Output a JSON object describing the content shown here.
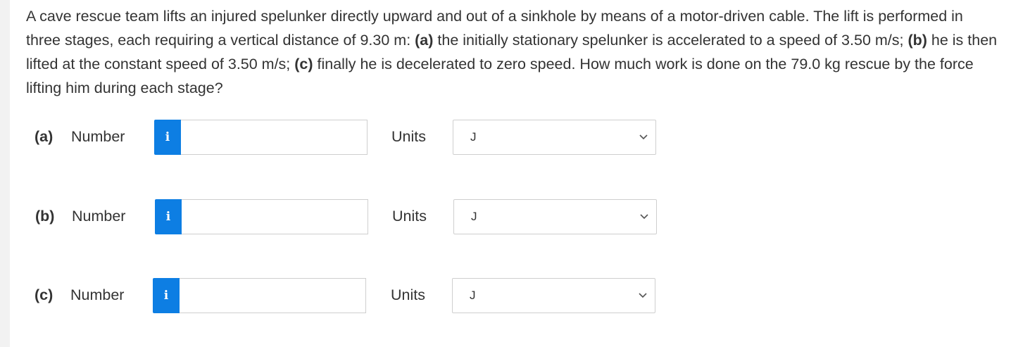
{
  "question": {
    "seg1": "A cave rescue team lifts an injured spelunker directly upward and out of a sinkhole by means of a motor-driven cable. The lift is performed in three stages, each requiring a vertical distance of 9.30 m: ",
    "label_a": "(a)",
    "seg2": " the initially stationary spelunker is accelerated to a speed of 3.50 m/s; ",
    "label_b": "(b)",
    "seg3": " he is then lifted at the constant speed of 3.50 m/s; ",
    "label_c": "(c)",
    "seg4": " finally he is decelerated to zero speed. How much work is done on the 79.0 kg rescue by the force lifting him during each stage?"
  },
  "parts": [
    {
      "label": "(a)",
      "number_label": "Number",
      "info_icon": "i",
      "value": "",
      "units_label": "Units",
      "units_value": "J"
    },
    {
      "label": "(b)",
      "number_label": "Number",
      "info_icon": "i",
      "value": "",
      "units_label": "Units",
      "units_value": "J"
    },
    {
      "label": "(c)",
      "number_label": "Number",
      "info_icon": "i",
      "value": "",
      "units_label": "Units",
      "units_value": "J"
    }
  ],
  "colors": {
    "info_button": "#0d7ee3",
    "background": "#f2f2f2",
    "card": "#ffffff",
    "text": "#333333",
    "border": "#cfcfcf"
  },
  "icons": {
    "info": "info-icon",
    "dropdown": "chevron-down-icon"
  }
}
